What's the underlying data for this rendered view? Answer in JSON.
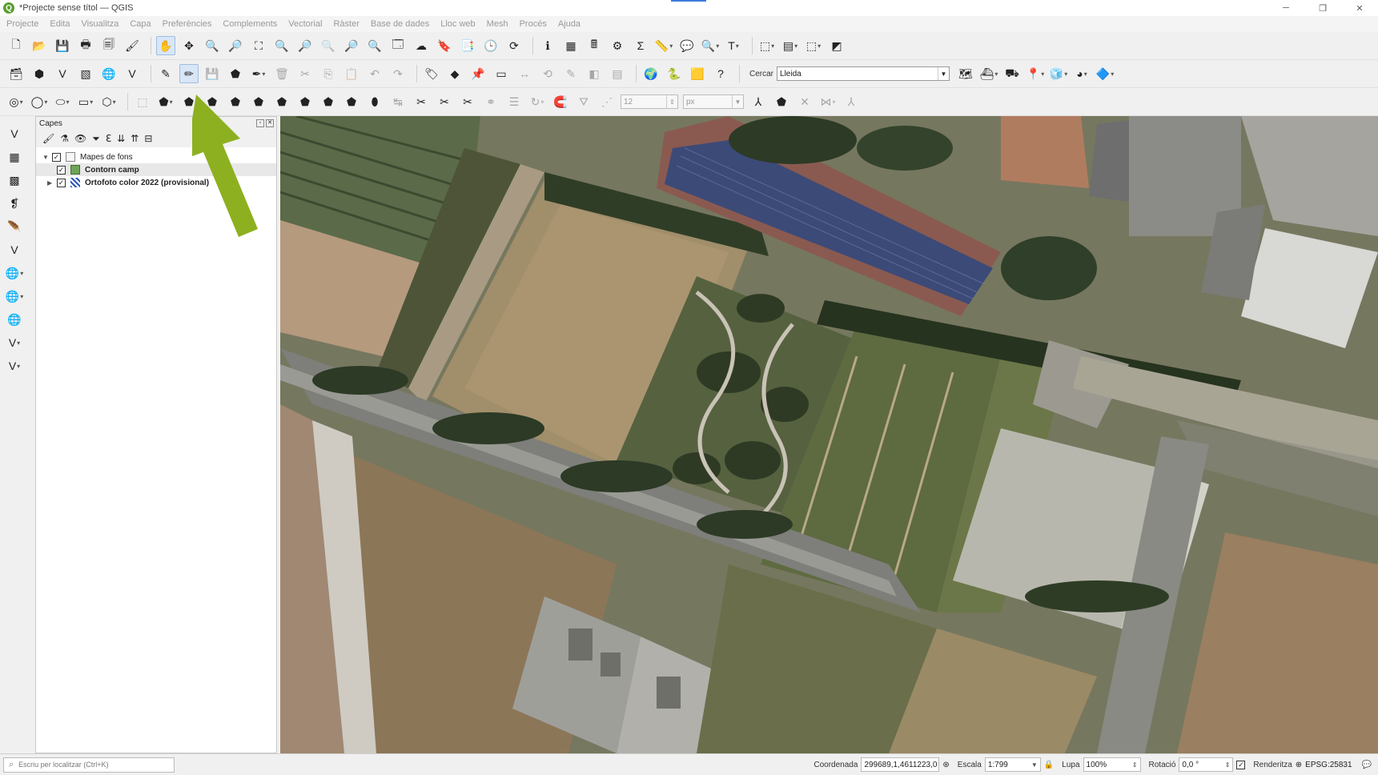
{
  "window": {
    "title": "*Projecte sense títol — QGIS"
  },
  "menu": [
    "Projecte",
    "Edita",
    "Visualitza",
    "Capa",
    "Preferències",
    "Complements",
    "Vectorial",
    "Ràster",
    "Base de dades",
    "Lloc web",
    "Mesh",
    "Procés",
    "Ajuda"
  ],
  "toolbar": {
    "search_label": "Cercar",
    "search_value": "Lleida"
  },
  "digitizing": {
    "size_value": "12",
    "size_unit": "px"
  },
  "layers_panel": {
    "title": "Capes",
    "group_name": "Mapes de fons",
    "layers": [
      {
        "name": "Contorn camp",
        "type": "polygon",
        "checked": true,
        "selected": true
      },
      {
        "name": "Ortofoto color 2022 (provisional)",
        "type": "raster",
        "checked": true,
        "selected": false
      }
    ]
  },
  "status": {
    "locator_placeholder": "Escriu per localitzar (Ctrl+K)",
    "coord_label": "Coordenada",
    "coord_value": "299689,1,4611223,0",
    "scale_label": "Escala",
    "scale_value": "1:799",
    "magnifier_label": "Lupa",
    "magnifier_value": "100%",
    "rotation_label": "Rotació",
    "rotation_value": "0,0 °",
    "render_label": "Renderitza",
    "crs": "EPSG:25831"
  },
  "annotation": {
    "arrow_color": "#8db020"
  }
}
